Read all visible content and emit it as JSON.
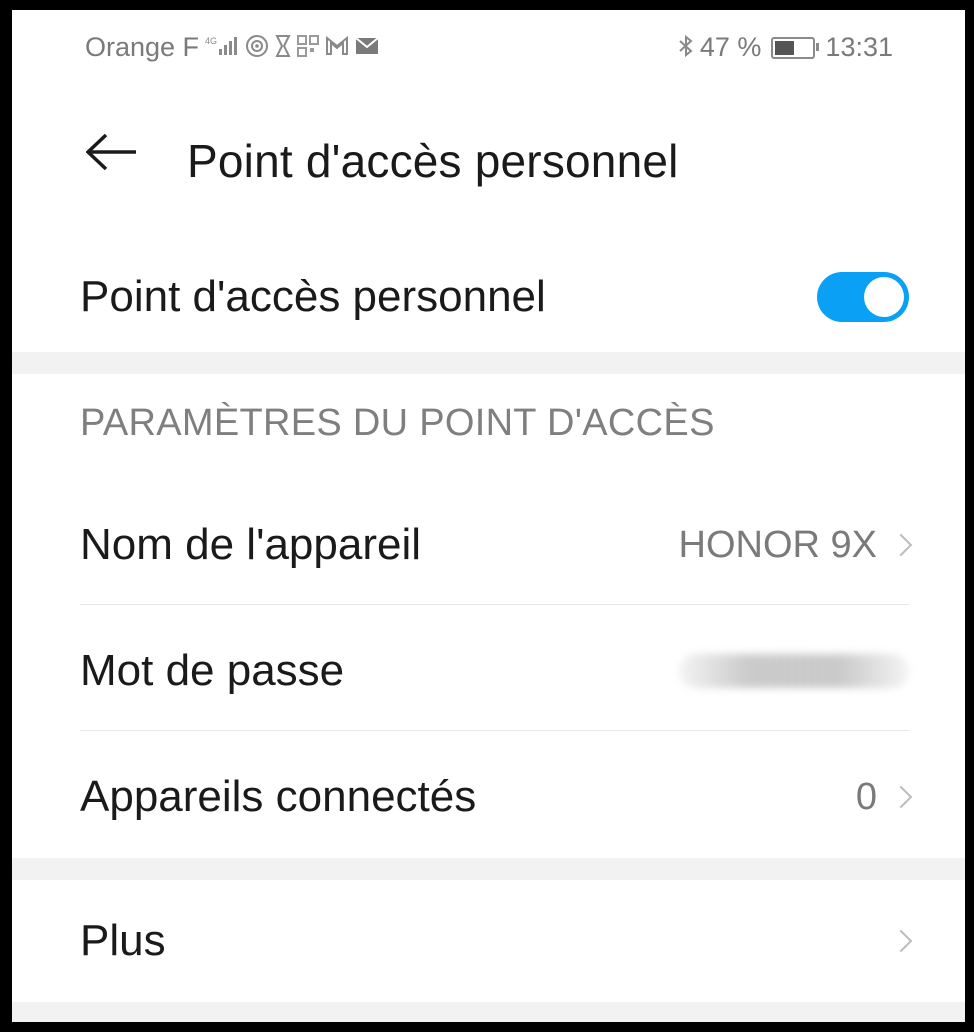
{
  "status_bar": {
    "carrier": "Orange F",
    "network": "4G",
    "battery_percent": "47 %",
    "battery_level": 0.47,
    "time": "13:31",
    "icons": [
      "signal-icon",
      "hotspot-icon",
      "hourglass-icon",
      "qr-icon",
      "gmail-icon",
      "mail-icon",
      "bluetooth-icon",
      "battery-icon"
    ]
  },
  "header": {
    "title": "Point d'accès personnel"
  },
  "hotspot": {
    "label": "Point d'accès personnel",
    "enabled": true,
    "accent_color": "#0aa0f5"
  },
  "settings": {
    "section_title": "PARAMÈTRES DU POINT D'ACCÈS",
    "items": [
      {
        "label": "Nom de l'appareil",
        "value": "HONOR 9X"
      },
      {
        "label": "Mot de passe",
        "value": ""
      },
      {
        "label": "Appareils connectés",
        "value": "0"
      }
    ]
  },
  "more": {
    "label": "Plus"
  }
}
